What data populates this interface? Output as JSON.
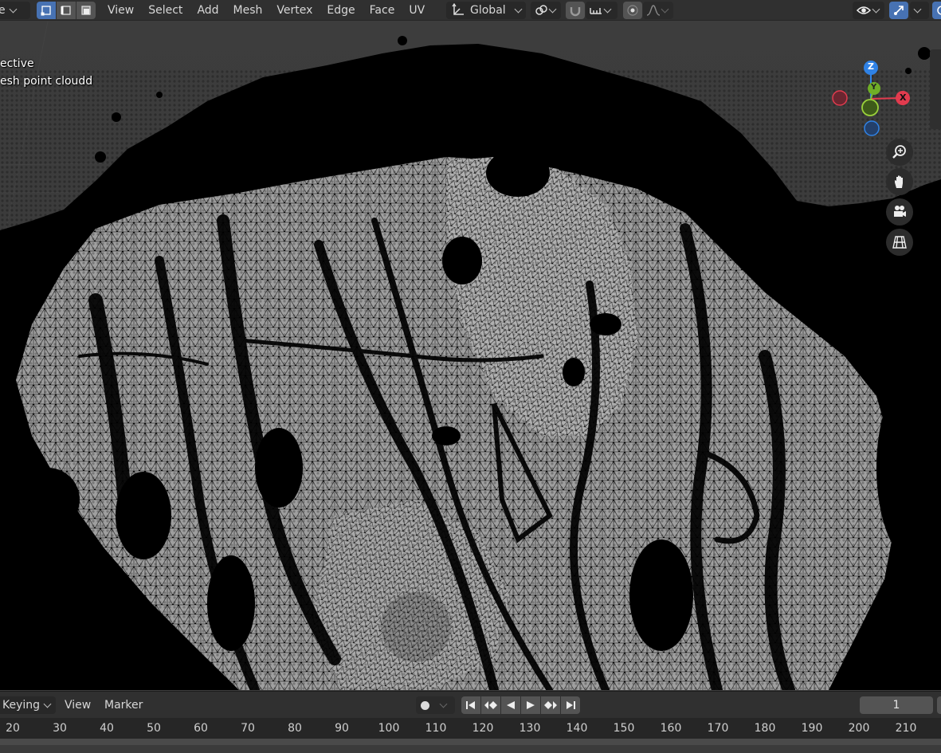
{
  "header": {
    "mode_dropdown": {
      "label": "e"
    },
    "select_modes": [
      {
        "name": "vertex-select",
        "active": true
      },
      {
        "name": "edge-select",
        "active": false
      },
      {
        "name": "face-select",
        "active": false
      }
    ],
    "menus": [
      "View",
      "Select",
      "Add",
      "Mesh",
      "Vertex",
      "Edge",
      "Face",
      "UV"
    ],
    "transform_orientation": "Global"
  },
  "viewport": {
    "view_label": "ective",
    "object_label": "esh point cloudd",
    "gizmo": {
      "x": "X",
      "y": "Y",
      "z": "Z"
    },
    "nav_icons": [
      "zoom-icon",
      "hand-pan-icon",
      "camera-icon",
      "perspective-grid-icon"
    ],
    "colors": {
      "background": "#3a3a3a",
      "mesh_light": "#a9a9a9",
      "mesh_dark": "#000000",
      "x_axis": "#e23b4e",
      "y_axis": "#7fbf2e",
      "z_axis": "#2f82e6"
    }
  },
  "timeline": {
    "keying_label": "Keying",
    "menus": [
      "View",
      "Marker"
    ],
    "current_frame": "1",
    "ruler": [
      "20",
      "30",
      "40",
      "50",
      "60",
      "70",
      "80",
      "90",
      "100",
      "110",
      "120",
      "130",
      "140",
      "150",
      "160",
      "170",
      "180",
      "190",
      "200",
      "210"
    ]
  }
}
